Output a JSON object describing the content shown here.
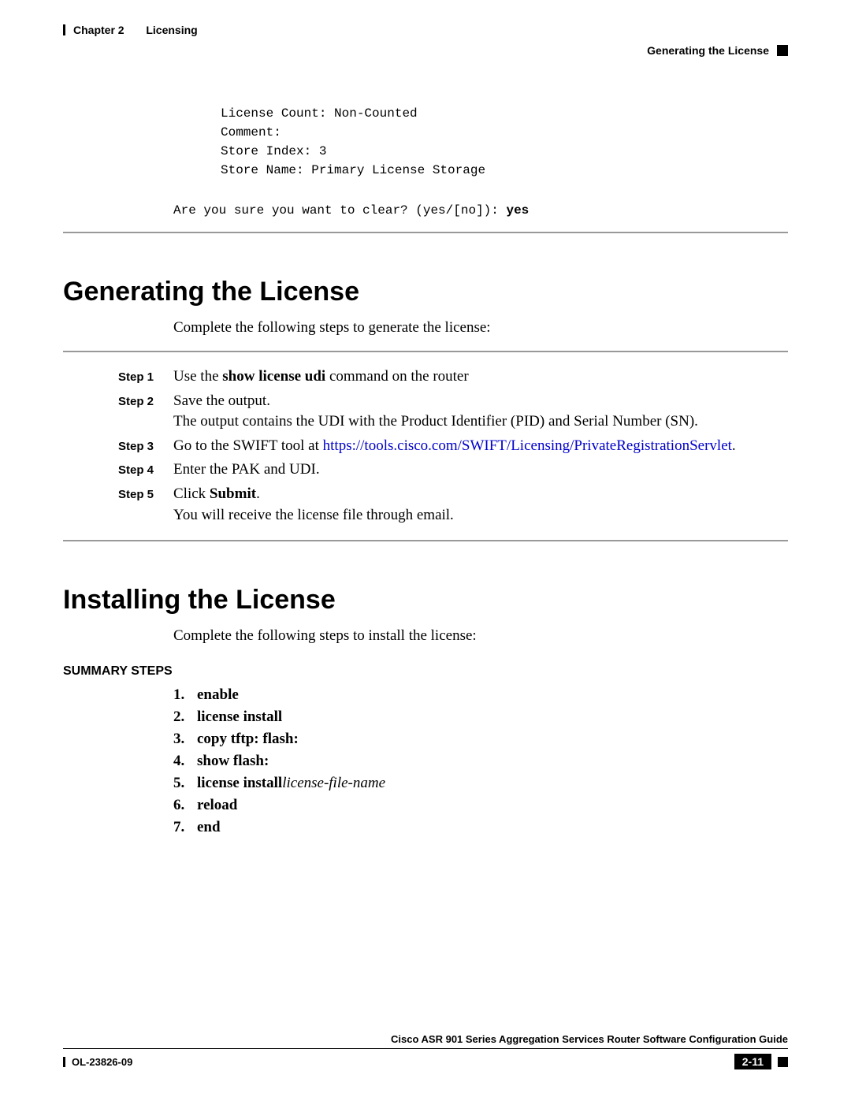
{
  "header": {
    "chapter_label": "Chapter 2",
    "chapter_title": "Licensing",
    "section_title": "Generating the License"
  },
  "terminal": {
    "line1": "License Count: Non-Counted",
    "line2": "Comment:",
    "line3": "Store Index: 3",
    "line4": "Store Name: Primary License Storage",
    "prompt_prefix": "Are you sure you want to clear? (yes/[no]): ",
    "prompt_answer": "yes"
  },
  "section1": {
    "heading": "Generating the License",
    "intro": "Complete the following steps to generate the license:",
    "steps": [
      {
        "label": "Step 1",
        "pre": "Use the ",
        "bold1": "show license udi",
        "post": " command on the router"
      },
      {
        "label": "Step 2",
        "line1": "Save the output.",
        "line2": "The output contains the UDI with the Product Identifier (PID) and Serial Number (SN)."
      },
      {
        "label": "Step 3",
        "pre": "Go to the SWIFT tool at ",
        "link": "https://tools.cisco.com/SWIFT/Licensing/PrivateRegistrationServlet",
        "post": "."
      },
      {
        "label": "Step 4",
        "text": "Enter the PAK and UDI."
      },
      {
        "label": "Step 5",
        "pre": "Click ",
        "bold1": "Submit",
        "post": ".",
        "line2": "You will receive the license file through email."
      }
    ]
  },
  "section2": {
    "heading": "Installing the License",
    "intro": "Complete the following steps to install the license:",
    "summary_label": "SUMMARY STEPS",
    "items": [
      {
        "n": "1.",
        "cmd": "enable"
      },
      {
        "n": "2.",
        "cmd": "license install"
      },
      {
        "n": "3.",
        "cmd": "copy tftp: flash:"
      },
      {
        "n": "4.",
        "cmd": "show flash:"
      },
      {
        "n": "5.",
        "cmd": "license install",
        "ital": " license-file-name"
      },
      {
        "n": "6.",
        "cmd": "reload"
      },
      {
        "n": "7.",
        "cmd": "end"
      }
    ]
  },
  "footer": {
    "guide_title": "Cisco ASR 901 Series Aggregation Services Router Software Configuration Guide",
    "doc_id": "OL-23826-09",
    "page_num": "2-11"
  }
}
